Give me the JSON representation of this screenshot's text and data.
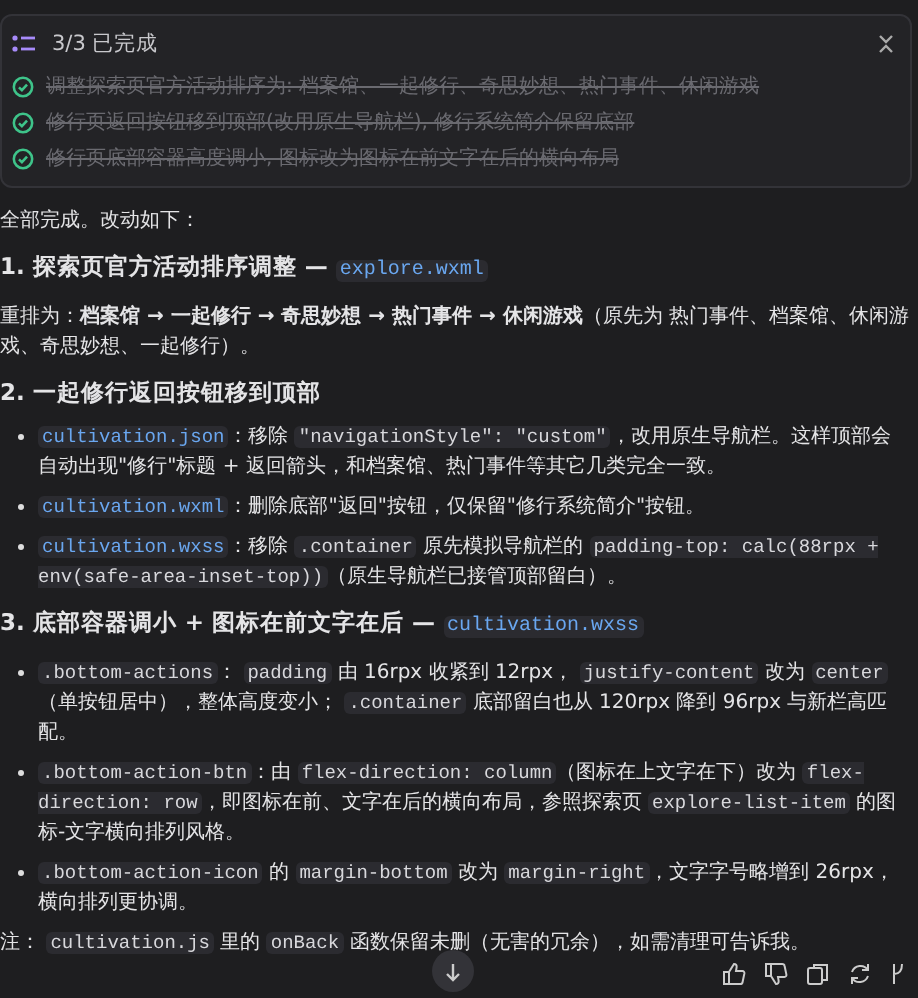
{
  "tasks": {
    "summary": "3/3 已完成",
    "items": [
      {
        "text": "调整探索页官方活动排序为: 档案馆、一起修行、奇思妙想、热门事件、休闲游戏",
        "done": true
      },
      {
        "text": "修行页返回按钮移到顶部(改用原生导航栏), 修行系统简介保留底部",
        "done": true
      },
      {
        "text": "修行页底部容器高度调小, 图标改为图标在前文字在后的横向布局",
        "done": true
      }
    ]
  },
  "blocks": [
    {
      "kind": "para",
      "segments": [
        {
          "kind": "text",
          "text": "全部完成。改动如下："
        }
      ]
    },
    {
      "kind": "heading",
      "segments": [
        {
          "kind": "text",
          "text": "1. 探索页官方活动排序调整 — "
        },
        {
          "kind": "code",
          "text": "explore.wxml"
        }
      ]
    },
    {
      "kind": "para",
      "segments": [
        {
          "kind": "text",
          "text": "重排为："
        },
        {
          "kind": "bold",
          "text": "档案馆 → 一起修行 → 奇思妙想 → 热门事件 → 休闲游戏"
        },
        {
          "kind": "text",
          "text": "（原先为 热门事件、档案馆、休闲游戏、奇思妙想、一起修行）。"
        }
      ]
    },
    {
      "kind": "heading",
      "segments": [
        {
          "kind": "text",
          "text": "2. 一起修行返回按钮移到顶部"
        }
      ]
    },
    {
      "kind": "bullet",
      "segments": [
        {
          "kind": "file",
          "text": "cultivation.json"
        },
        {
          "kind": "text",
          "text": "：移除 "
        },
        {
          "kind": "code",
          "text": "\"navigationStyle\": \"custom\""
        },
        {
          "kind": "text",
          "text": "，改用原生导航栏。这样顶部会自动出现\"修行\"标题 + 返回箭头，和档案馆、热门事件等其它几类完全一致。"
        }
      ]
    },
    {
      "kind": "bullet",
      "segments": [
        {
          "kind": "file",
          "text": "cultivation.wxml"
        },
        {
          "kind": "text",
          "text": "：删除底部\"返回\"按钮，仅保留\"修行系统简介\"按钮。"
        }
      ]
    },
    {
      "kind": "bullet",
      "segments": [
        {
          "kind": "file",
          "text": "cultivation.wxss"
        },
        {
          "kind": "text",
          "text": "：移除 "
        },
        {
          "kind": "code",
          "text": ".container"
        },
        {
          "kind": "text",
          "text": " 原先模拟导航栏的 "
        },
        {
          "kind": "code",
          "text": "padding-top: calc(88rpx + env(safe-area-inset-top))"
        },
        {
          "kind": "text",
          "text": "（原生导航栏已接管顶部留白）。"
        }
      ]
    },
    {
      "kind": "heading",
      "segments": [
        {
          "kind": "text",
          "text": "3. 底部容器调小 + 图标在前文字在后 — "
        },
        {
          "kind": "code",
          "text": "cultivation.wxss"
        }
      ]
    },
    {
      "kind": "bullet",
      "segments": [
        {
          "kind": "code",
          "text": ".bottom-actions"
        },
        {
          "kind": "text",
          "text": "： "
        },
        {
          "kind": "code",
          "text": "padding"
        },
        {
          "kind": "text",
          "text": " 由 16rpx 收紧到 12rpx， "
        },
        {
          "kind": "code",
          "text": "justify-content"
        },
        {
          "kind": "text",
          "text": " 改为 "
        },
        {
          "kind": "code",
          "text": "center"
        },
        {
          "kind": "text",
          "text": "（单按钮居中），整体高度变小； "
        },
        {
          "kind": "code",
          "text": ".container"
        },
        {
          "kind": "text",
          "text": " 底部留白也从 120rpx 降到 96rpx 与新栏高匹配。"
        }
      ]
    },
    {
      "kind": "bullet",
      "segments": [
        {
          "kind": "code",
          "text": ".bottom-action-btn"
        },
        {
          "kind": "text",
          "text": "：由 "
        },
        {
          "kind": "code",
          "text": "flex-direction: column"
        },
        {
          "kind": "text",
          "text": "（图标在上文字在下）改为 "
        },
        {
          "kind": "code",
          "text": "flex-direction: row"
        },
        {
          "kind": "text",
          "text": "，即图标在前、文字在后的横向布局，参照探索页 "
        },
        {
          "kind": "code",
          "text": "explore-list-item"
        },
        {
          "kind": "text",
          "text": " 的图标-文字横向排列风格。"
        }
      ]
    },
    {
      "kind": "bullet",
      "segments": [
        {
          "kind": "code",
          "text": ".bottom-action-icon"
        },
        {
          "kind": "text",
          "text": " 的 "
        },
        {
          "kind": "code",
          "text": "margin-bottom"
        },
        {
          "kind": "text",
          "text": " 改为 "
        },
        {
          "kind": "code",
          "text": "margin-right"
        },
        {
          "kind": "text",
          "text": "，文字字号略增到 26rpx，横向排列更协调。"
        }
      ]
    },
    {
      "kind": "para",
      "segments": [
        {
          "kind": "text",
          "text": "注： "
        },
        {
          "kind": "code",
          "text": "cultivation.js"
        },
        {
          "kind": "text",
          "text": " 里的 "
        },
        {
          "kind": "code",
          "text": "onBack"
        },
        {
          "kind": "text",
          "text": " 函数保留未删（无害的冗余），如需清理可告诉我。"
        }
      ]
    }
  ]
}
